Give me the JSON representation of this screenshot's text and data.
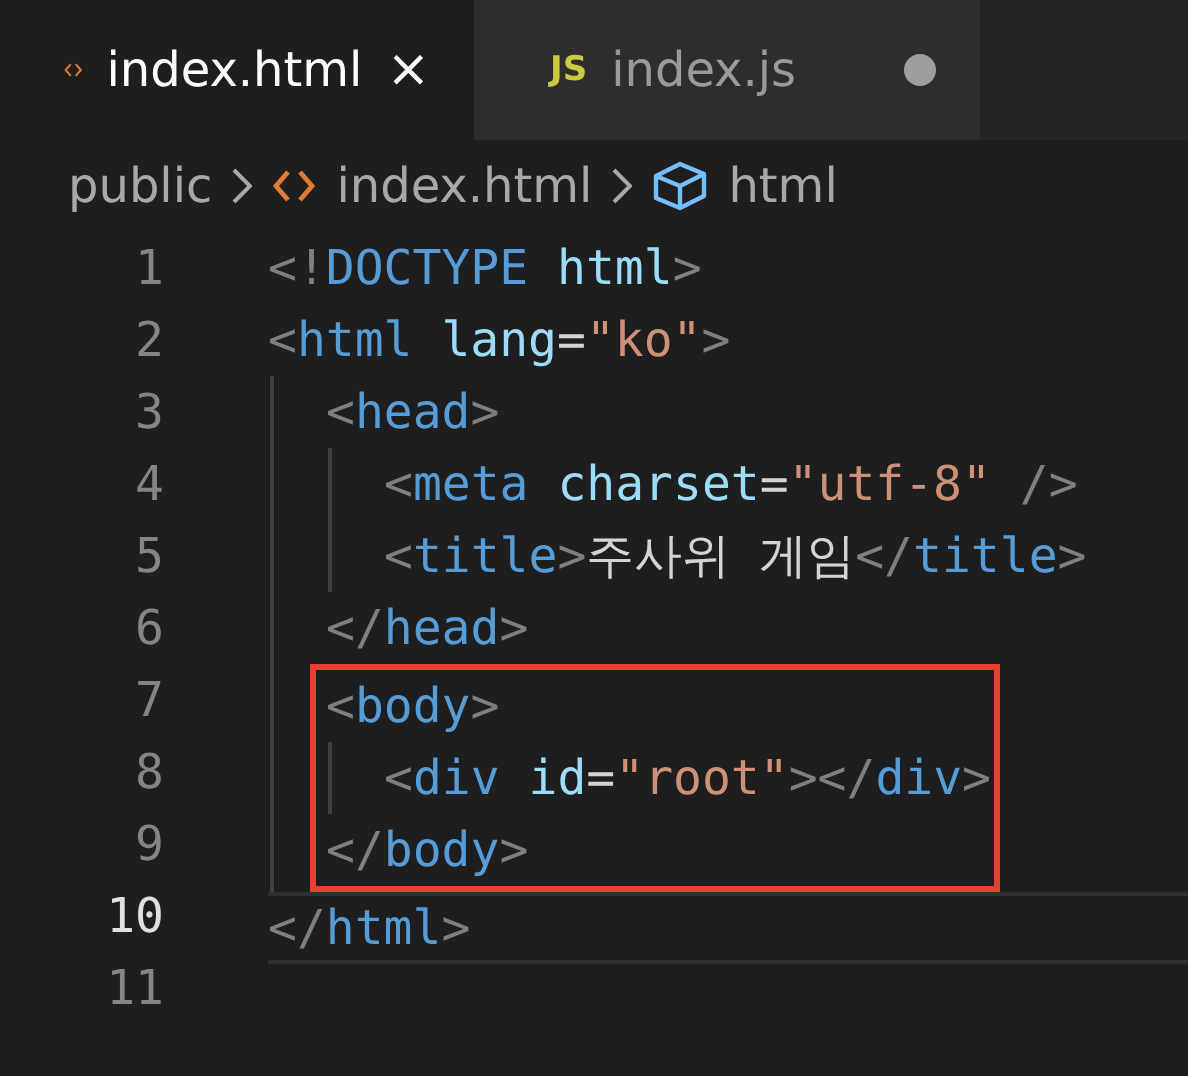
{
  "tabs": [
    {
      "kind": "html",
      "label": "index.html",
      "selected": true,
      "modified": false,
      "close": "×"
    },
    {
      "kind": "js",
      "badge": "JS",
      "label": "index.js",
      "selected": false,
      "modified": true
    }
  ],
  "breadcrumbs": [
    {
      "kind": "folder",
      "label": "public"
    },
    {
      "kind": "html",
      "label": "index.html"
    },
    {
      "kind": "element",
      "label": "html"
    }
  ],
  "lines": [
    {
      "kind": "line",
      "number": "1",
      "current": false,
      "tokens": [
        {
          "kind": "punct",
          "text": "<!"
        },
        {
          "kind": "tag",
          "text": "DOCTYPE"
        },
        {
          "kind": "attr",
          "text": " html"
        },
        {
          "kind": "punct",
          "text": ">"
        }
      ]
    },
    {
      "kind": "line",
      "number": "2",
      "current": false,
      "tokens": [
        {
          "kind": "punct",
          "text": "<"
        },
        {
          "kind": "tag",
          "text": "html"
        },
        {
          "kind": "attr",
          "text": " lang"
        },
        {
          "kind": "text",
          "text": "="
        },
        {
          "kind": "string",
          "text": "\"ko\""
        },
        {
          "kind": "punct",
          "text": ">"
        }
      ],
      "children": [
        {
          "kind": "line",
          "number": "3",
          "current": false,
          "tokens": [
            {
              "kind": "punct",
              "text": "<"
            },
            {
              "kind": "tag",
              "text": "head"
            },
            {
              "kind": "punct",
              "text": ">"
            }
          ],
          "children": [
            {
              "kind": "line",
              "number": "4",
              "current": false,
              "tokens": [
                {
                  "kind": "punct",
                  "text": "<"
                },
                {
                  "kind": "tag",
                  "text": "meta"
                },
                {
                  "kind": "attr",
                  "text": " charset"
                },
                {
                  "kind": "text",
                  "text": "="
                },
                {
                  "kind": "string",
                  "text": "\"utf-8\""
                },
                {
                  "kind": "punct",
                  "text": " />"
                }
              ]
            },
            {
              "kind": "line",
              "number": "5",
              "current": false,
              "tokens": [
                {
                  "kind": "punct",
                  "text": "<"
                },
                {
                  "kind": "tag",
                  "text": "title"
                },
                {
                  "kind": "punct",
                  "text": ">"
                },
                {
                  "kind": "text",
                  "text": "주사위 게임"
                },
                {
                  "kind": "punct",
                  "text": "</"
                },
                {
                  "kind": "tag",
                  "text": "title"
                },
                {
                  "kind": "punct",
                  "text": ">"
                }
              ]
            }
          ]
        },
        {
          "kind": "line",
          "number": "6",
          "current": false,
          "tokens": [
            {
              "kind": "punct",
              "text": "</"
            },
            {
              "kind": "tag",
              "text": "head"
            },
            {
              "kind": "punct",
              "text": ">"
            }
          ]
        },
        {
          "kind": "highlight",
          "children": [
            {
              "kind": "line",
              "number": "7",
              "current": false,
              "tokens": [
                {
                  "kind": "punct",
                  "text": "<"
                },
                {
                  "kind": "tag",
                  "text": "body"
                },
                {
                  "kind": "punct",
                  "text": ">"
                }
              ],
              "children": [
                {
                  "kind": "line",
                  "number": "8",
                  "current": false,
                  "tokens": [
                    {
                      "kind": "punct",
                      "text": "<"
                    },
                    {
                      "kind": "tag",
                      "text": "div"
                    },
                    {
                      "kind": "attr",
                      "text": " id"
                    },
                    {
                      "kind": "text",
                      "text": "="
                    },
                    {
                      "kind": "string",
                      "text": "\"root\""
                    },
                    {
                      "kind": "punct",
                      "text": "></"
                    },
                    {
                      "kind": "tag",
                      "text": "div"
                    },
                    {
                      "kind": "punct",
                      "text": ">"
                    }
                  ]
                }
              ]
            },
            {
              "kind": "line",
              "number": "9",
              "current": false,
              "tokens": [
                {
                  "kind": "punct",
                  "text": "</"
                },
                {
                  "kind": "tag",
                  "text": "body"
                },
                {
                  "kind": "punct",
                  "text": ">"
                }
              ]
            }
          ]
        }
      ]
    },
    {
      "kind": "line",
      "number": "10",
      "current": true,
      "tokens": [
        {
          "kind": "punct",
          "text": "</"
        },
        {
          "kind": "tag",
          "text": "html"
        },
        {
          "kind": "punct",
          "text": ">"
        }
      ]
    },
    {
      "kind": "line",
      "number": "11",
      "current": false
    }
  ]
}
